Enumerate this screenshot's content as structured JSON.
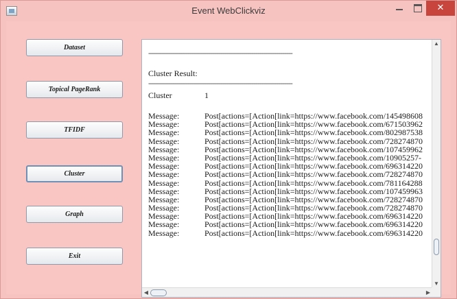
{
  "window": {
    "title": "Event WebClickviz",
    "close_glyph": "✕"
  },
  "sidebar": {
    "buttons": [
      {
        "label": "Dataset"
      },
      {
        "label": "Topical PageRank"
      },
      {
        "label": "TFIDF"
      },
      {
        "label": "Cluster"
      },
      {
        "label": "Graph"
      },
      {
        "label": "Exit"
      }
    ]
  },
  "output": {
    "rule": "----------------------------------------------------------------------",
    "result_label": "Cluster Result:",
    "cluster_label": "Cluster",
    "cluster_value": "1",
    "messages": [
      {
        "label": "Message:",
        "text": "Post[actions=[Action[link=https://www.facebook.com/145498608"
      },
      {
        "label": "Message:",
        "text": "Post[actions=[Action[link=https://www.facebook.com/671503962"
      },
      {
        "label": "Message:",
        "text": "Post[actions=[Action[link=https://www.facebook.com/802987538"
      },
      {
        "label": "Message:",
        "text": "Post[actions=[Action[link=https://www.facebook.com/728274870"
      },
      {
        "label": "Message:",
        "text": "Post[actions=[Action[link=https://www.facebook.com/107459962"
      },
      {
        "label": "Message:",
        "text": "Post[actions=[Action[link=https://www.facebook.com/10905257-"
      },
      {
        "label": "Message:",
        "text": "Post[actions=[Action[link=https://www.facebook.com/696314220"
      },
      {
        "label": "Message:",
        "text": "Post[actions=[Action[link=https://www.facebook.com/728274870"
      },
      {
        "label": "Message:",
        "text": "Post[actions=[Action[link=https://www.facebook.com/781164288"
      },
      {
        "label": "Message:",
        "text": "Post[actions=[Action[link=https://www.facebook.com/107459963"
      },
      {
        "label": "Message:",
        "text": "Post[actions=[Action[link=https://www.facebook.com/728274870"
      },
      {
        "label": "Message:",
        "text": "Post[actions=[Action[link=https://www.facebook.com/728274870"
      },
      {
        "label": "Message:",
        "text": "Post[actions=[Action[link=https://www.facebook.com/696314220"
      },
      {
        "label": "Message:",
        "text": "Post[actions=[Action[link=https://www.facebook.com/696314220"
      },
      {
        "label": "Message:",
        "text": "Post[actions=[Action[link=https://www.facebook.com/696314220"
      }
    ]
  },
  "scrollbars": {
    "up": "▲",
    "down": "▼",
    "left": "◀",
    "right": "▶"
  },
  "colors": {
    "window_bg": "#f7c3c0",
    "close_button": "#c7453c",
    "panel_bg": "#ffffff"
  }
}
